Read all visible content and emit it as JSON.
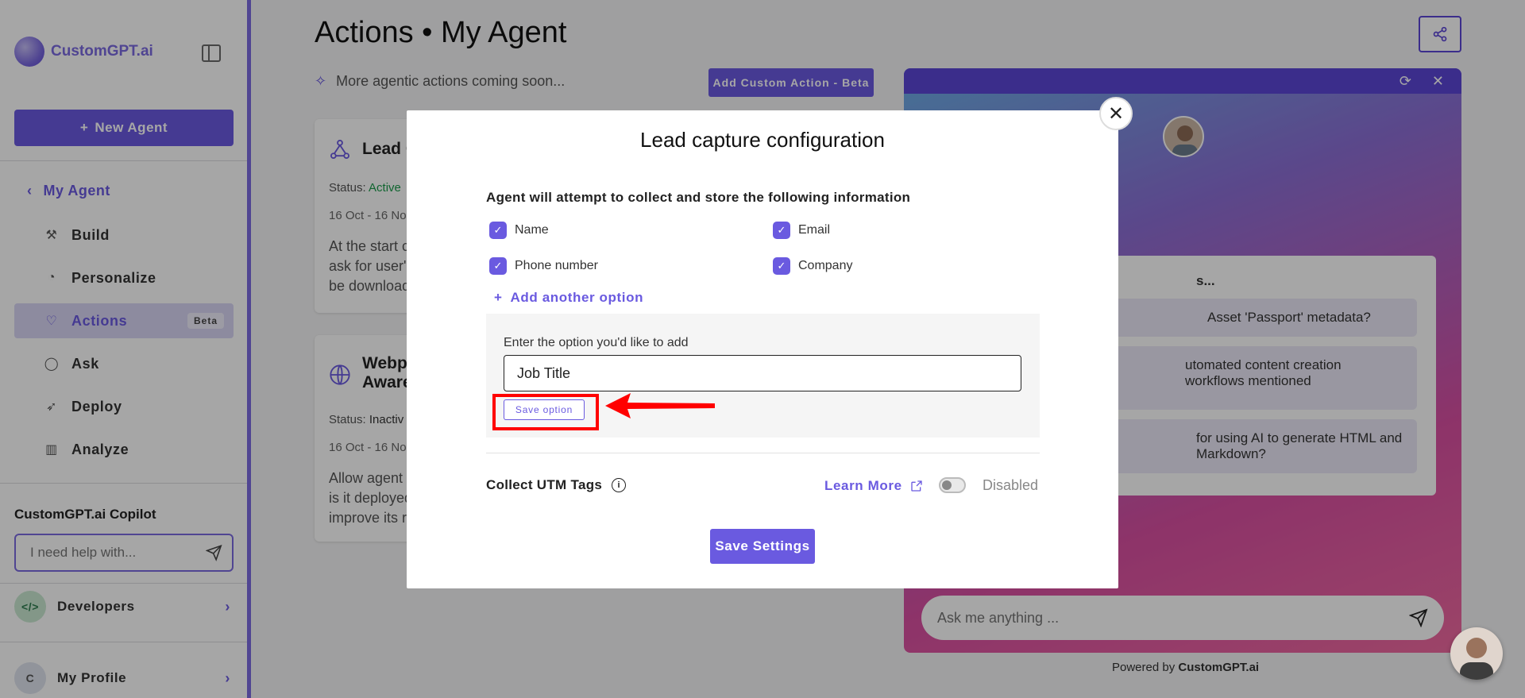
{
  "sidebar": {
    "brand": "CustomGPT.ai",
    "new_agent_label": "New Agent",
    "back_label": "My Agent",
    "nav": [
      {
        "label": "Build",
        "icon": "hammer-icon"
      },
      {
        "label": "Personalize",
        "icon": "palette-icon"
      },
      {
        "label": "Actions",
        "icon": "heart-hand-icon",
        "badge": "Beta",
        "active": true
      },
      {
        "label": "Ask",
        "icon": "chat-bubble-icon"
      },
      {
        "label": "Deploy",
        "icon": "rocket-icon"
      },
      {
        "label": "Analyze",
        "icon": "bar-chart-icon"
      }
    ],
    "copilot_title": "CustomGPT.ai Copilot",
    "copilot_placeholder": "I need help with...",
    "developers_label": "Developers",
    "profile_label": "My Profile",
    "profile_initial": "C"
  },
  "main": {
    "title": "Actions • My Agent",
    "coming_soon": "More agentic actions coming soon...",
    "add_custom_action": "Add Custom Action - Beta",
    "cards": [
      {
        "title": "Lead C",
        "status_label": "Status:",
        "status_value": "Active",
        "date": "16 Oct - 16 No",
        "desc": [
          "At the start c",
          "ask for user's",
          "be download"
        ]
      },
      {
        "title": "Webpa",
        "title_line2": "Aware",
        "status_label": "Status:",
        "status_value": "Inactiv",
        "date": "16 Oct - 16 No",
        "desc": [
          "Allow agent",
          "is it deployed",
          "improve its r"
        ]
      }
    ]
  },
  "chat": {
    "panel_heading": "s...",
    "suggestions": [
      "Asset 'Passport' metadata?",
      "utomated content creation workflows mentioned",
      "for using AI to generate HTML and Markdown?"
    ],
    "input_placeholder": "Ask me anything ...",
    "powered_prefix": "Powered by ",
    "powered_brand": "CustomGPT.ai"
  },
  "modal": {
    "title": "Lead capture configuration",
    "subtitle": "Agent will attempt to collect and store the following information",
    "options": [
      "Name",
      "Email",
      "Phone number",
      "Company"
    ],
    "add_option_label": "Add another option",
    "input_label": "Enter the option you'd like to add",
    "input_value": "Job Title",
    "save_option_label": "Save option",
    "utm_label": "Collect UTM Tags",
    "learn_more": "Learn More",
    "toggle_state": "Disabled",
    "save_settings": "Save Settings"
  },
  "colors": {
    "accent": "#6a5ae0",
    "highlight": "#ff0000",
    "active_status": "#1a9c4a"
  }
}
